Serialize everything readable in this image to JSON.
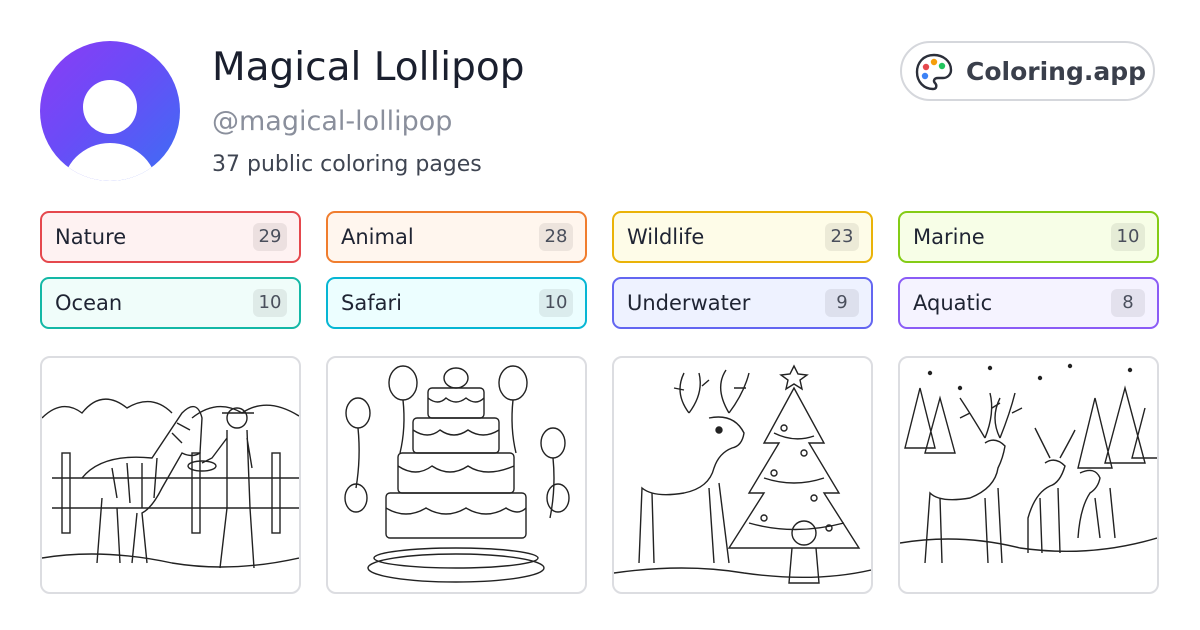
{
  "profile": {
    "name": "Magical Lollipop",
    "handle": "@magical-lollipop",
    "count_text": "37 public coloring pages",
    "avatar_gradient": [
      "#8b3cf6",
      "#3b6ff4"
    ]
  },
  "brand": {
    "label": "Coloring.app",
    "icon": "palette-icon"
  },
  "tags": [
    {
      "label": "Nature",
      "count": "29",
      "border": "#e5484d",
      "bg": "#fef2f2"
    },
    {
      "label": "Animal",
      "count": "28",
      "border": "#f07d2e",
      "bg": "#fff6ee"
    },
    {
      "label": "Wildlife",
      "count": "23",
      "border": "#eab308",
      "bg": "#fefce8"
    },
    {
      "label": "Marine",
      "count": "10",
      "border": "#84cc16",
      "bg": "#f7fee7"
    },
    {
      "label": "Ocean",
      "count": "10",
      "border": "#14b8a6",
      "bg": "#f0fdfa"
    },
    {
      "label": "Safari",
      "count": "10",
      "border": "#06b6d4",
      "bg": "#ecfeff"
    },
    {
      "label": "Underwater",
      "count": "9",
      "border": "#6366f1",
      "bg": "#eef2ff"
    },
    {
      "label": "Aquatic",
      "count": "8",
      "border": "#8b5cf6",
      "bg": "#f5f3ff"
    }
  ],
  "thumbnails": [
    {
      "subject": "zebra-zookeeper-icon"
    },
    {
      "subject": "birthday-cake-icon"
    },
    {
      "subject": "reindeer-christmas-tree-icon"
    },
    {
      "subject": "deer-winter-forest-icon"
    }
  ]
}
